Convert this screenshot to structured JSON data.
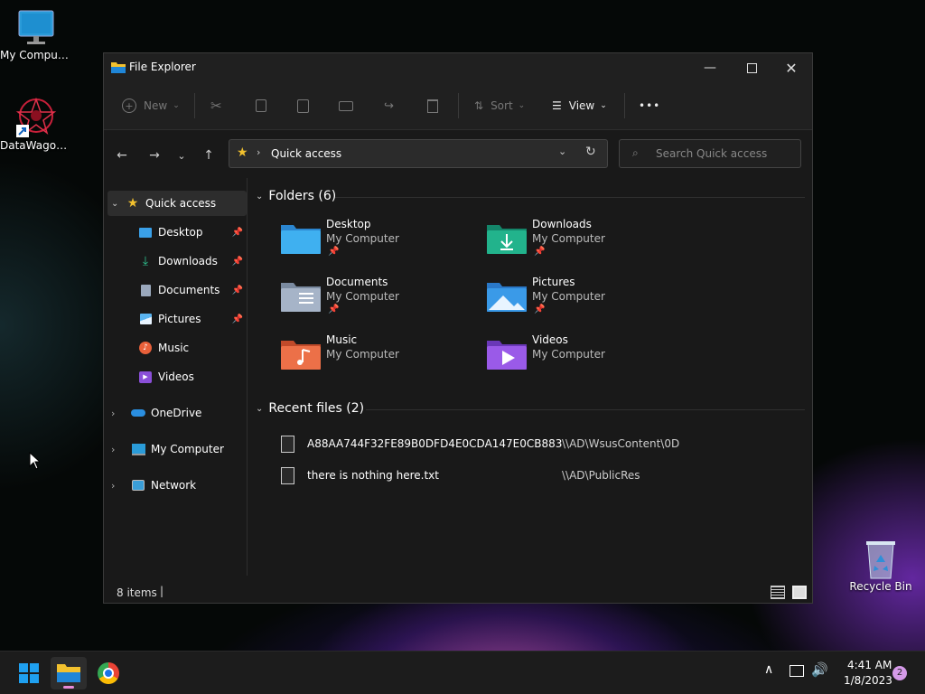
{
  "desktop": {
    "icons": [
      {
        "label": "My Computer",
        "icon": "monitor-icon"
      },
      {
        "label": "DataWagon...",
        "icon": "datawagon-shortcut-icon"
      },
      {
        "label": "Recycle Bin",
        "icon": "recycle-bin-icon"
      }
    ]
  },
  "window": {
    "title": "File Explorer",
    "toolbar": {
      "new_label": "New",
      "sort_label": "Sort",
      "view_label": "View",
      "more_label": "•••"
    },
    "address": {
      "location": "Quick access"
    },
    "search": {
      "placeholder": "Search Quick access"
    },
    "sidebar": {
      "quick_access": "Quick access",
      "items": [
        {
          "label": "Desktop",
          "icon": "desktop-folder-icon",
          "pinned": true
        },
        {
          "label": "Downloads",
          "icon": "downloads-icon",
          "pinned": true
        },
        {
          "label": "Documents",
          "icon": "documents-icon",
          "pinned": true
        },
        {
          "label": "Pictures",
          "icon": "pictures-icon",
          "pinned": true
        },
        {
          "label": "Music",
          "icon": "music-icon",
          "pinned": false
        },
        {
          "label": "Videos",
          "icon": "videos-icon",
          "pinned": false
        }
      ],
      "roots": [
        {
          "label": "OneDrive",
          "icon": "onedrive-icon"
        },
        {
          "label": "My Computer",
          "icon": "computer-icon"
        },
        {
          "label": "Network",
          "icon": "network-icon"
        }
      ]
    },
    "folders_header": "Folders (6)",
    "folders": [
      {
        "name": "Desktop",
        "location": "My Computer",
        "pinned": true,
        "color": "#3aa0e8"
      },
      {
        "name": "Downloads",
        "location": "My Computer",
        "pinned": true,
        "color": "#1fa67a"
      },
      {
        "name": "Documents",
        "location": "My Computer",
        "pinned": true,
        "color": "#8b9bb3"
      },
      {
        "name": "Pictures",
        "location": "My Computer",
        "pinned": true,
        "color": "#3a8ee6"
      },
      {
        "name": "Music",
        "location": "My Computer",
        "pinned": false,
        "color": "#e0663a"
      },
      {
        "name": "Videos",
        "location": "My Computer",
        "pinned": false,
        "color": "#8a4fd8"
      }
    ],
    "recent_header": "Recent files (2)",
    "recent": [
      {
        "name": "A88AA744F32FE89B0DFD4E0CDA147E0CB883A60...",
        "path": "\\\\AD\\WsusContent\\0D"
      },
      {
        "name": "there is nothing here.txt",
        "path": "\\\\AD\\PublicRes"
      }
    ],
    "status": {
      "items": "8 items"
    }
  },
  "taskbar": {
    "time": "4:41 AM",
    "date": "1/8/2023",
    "notifications": "2"
  },
  "colors": {
    "accent_yellow": "#f2c12e",
    "window_bg": "#191919",
    "selected_bg": "#2d2d2d"
  }
}
